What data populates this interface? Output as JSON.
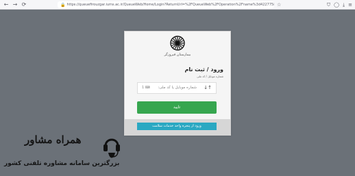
{
  "browser": {
    "nav_icons": [
      "←",
      "→",
      "⟳"
    ],
    "url": "https://queuefirouzgar.iums.ac.ir/QueueWeb/Home/Login?ReturnUrl=%2FQueueWeb%2FOperation%2Fname%3d4227758..."
  },
  "login": {
    "hospital_name": "بیمارستان فیروزگر",
    "title": "ورود / ثبت نام",
    "field_label": "شماره موبایل / کد ملی",
    "input_placeholder": "شماره موبایل یا کد ملی:",
    "input_side_hint": "1 ⌨",
    "sort_icon": "↓↑",
    "submit_label": "تایید",
    "portal_button_label": "ورود از پنجره واحد خدمات سلامت"
  },
  "watermark": {
    "brand": "همراه مشاور",
    "tagline": "بزرگترین سامانه مشاوره تلفنی کشور"
  }
}
